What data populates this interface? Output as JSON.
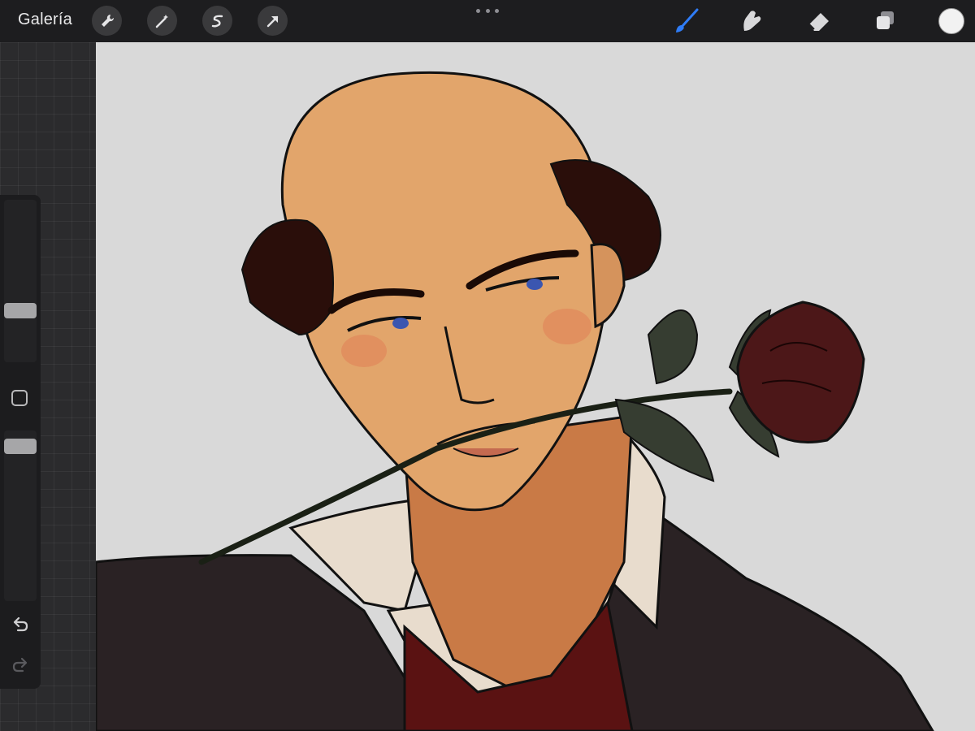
{
  "app": {
    "gallery_label": "Galería"
  },
  "toolbar": {
    "left_tools": [
      "actions-wrench-icon",
      "adjustments-wand-icon",
      "selection-icon",
      "transform-arrow-icon"
    ],
    "right_tools": [
      "brush-icon",
      "smudge-icon",
      "eraser-icon",
      "layers-icon"
    ],
    "active_tool": "brush-icon",
    "active_color": "#f2f2f2"
  },
  "sidebar": {
    "brush_size_level": 0.3,
    "opacity_level": 0.95
  },
  "colors": {
    "topbar": "#1d1d1f",
    "accent": "#2f7cf6",
    "canvas_bg": "#d9d9d9"
  }
}
